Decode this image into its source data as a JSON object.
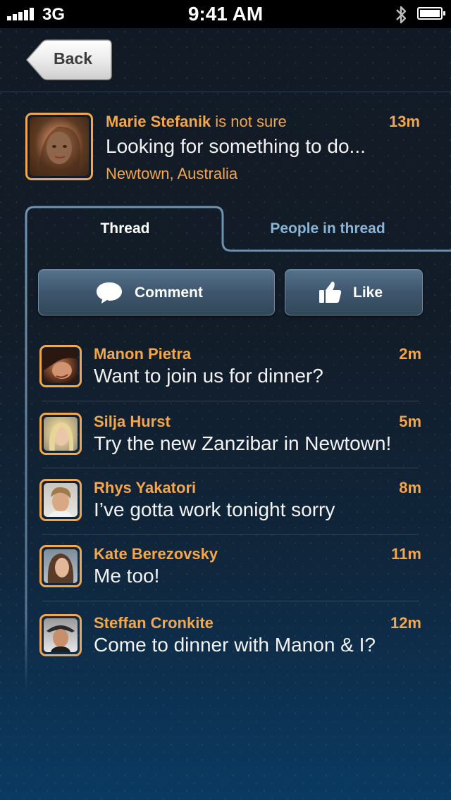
{
  "status_bar": {
    "carrier": "3G",
    "time": "9:41 AM",
    "signal_icon": "signal-bars-icon",
    "bluetooth_icon": "bluetooth-icon",
    "battery_icon": "battery-icon"
  },
  "nav": {
    "back_label": "Back"
  },
  "post": {
    "author": "Marie Stefanik",
    "status": " is not sure",
    "time": "13m",
    "text": "Looking for something to do...",
    "location": "Newtown, Australia"
  },
  "tabs": {
    "thread": "Thread",
    "people": "People in thread"
  },
  "actions": {
    "comment": "Comment",
    "like": "Like",
    "comment_icon": "speech-bubble-icon",
    "like_icon": "thumbs-up-icon"
  },
  "thread": [
    {
      "name": "Manon Pietra",
      "time": "2m",
      "text": "Want to join us for dinner?"
    },
    {
      "name": "Silja Hurst",
      "time": "5m",
      "text": "Try the new Zanzibar in Newtown!"
    },
    {
      "name": "Rhys Yakatori",
      "time": "8m",
      "text": "I’ve gotta work tonight sorry"
    },
    {
      "name": "Kate Berezovsky",
      "time": "11m",
      "text": "Me too!"
    },
    {
      "name": "Steffan Cronkite",
      "time": "12m",
      "text": "Come to dinner with Manon & I?"
    }
  ],
  "colors": {
    "accent": "#f4a64a",
    "text": "#f3f3f3",
    "tab_inactive": "#8ab4d6",
    "outline": "#6f93b3"
  }
}
